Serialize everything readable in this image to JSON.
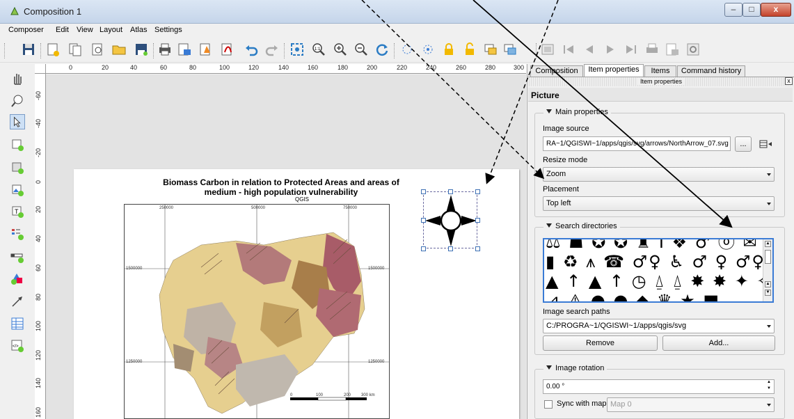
{
  "window": {
    "title": "Composition 1"
  },
  "menu": [
    "Composer",
    "Edit",
    "View",
    "Layout",
    "Atlas",
    "Settings"
  ],
  "ruler": {
    "h_labels": [
      "0",
      "20",
      "40",
      "60",
      "80",
      "100",
      "120",
      "140",
      "160",
      "180",
      "200",
      "220",
      "240",
      "260",
      "280",
      "300"
    ],
    "v_labels": [
      "-60",
      "-40",
      "-20",
      "0",
      "20",
      "40",
      "60",
      "80",
      "100",
      "120",
      "140",
      "160"
    ]
  },
  "map": {
    "title": "Biomass Carbon in relation to Protected Areas and areas of medium - high population vulnerability",
    "qgis_label": "QGIS",
    "coords": {
      "top_left": "250000",
      "top_mid": "500000",
      "top_right": "750000",
      "left_1": "1500000",
      "right_1": "1500000",
      "left_2": "1250000",
      "right_2": "1250000",
      "bottom_left": "250000",
      "bottom_mid": "500000",
      "bottom_right": "750000"
    },
    "scalebar": [
      "0",
      "100",
      "200",
      "300 km"
    ]
  },
  "panel": {
    "tabs": [
      "Composition",
      "Item properties",
      "Items",
      "Command history"
    ],
    "active_tab": "Item properties",
    "dock_title": "Item properties",
    "section": "Picture",
    "main_properties": {
      "title": "Main properties",
      "image_source_label": "Image source",
      "image_source_value": "RA~1/QGISWI~1/apps/qgis/svg/arrows/NorthArrow_07.svg",
      "browse_label": "...",
      "resize_mode_label": "Resize mode",
      "resize_mode_value": "Zoom",
      "placement_label": "Placement",
      "placement_value": "Top left"
    },
    "search_directories": {
      "title": "Search directories",
      "symbols_row1": "⚖ ☗ ✪ ✪ ♜ Ⅰ ❖ ♂ ⓞ ✉ ✉",
      "symbols_row2": "▮ ♻ ⩚ ☎ ♂♀ ♿ ♂ ♀ ♂♀ ⬆ ▲",
      "symbols_row3": "▲ ↑ ▲ ↑ ◷ ⍙ ⍙ ✸ ✸ ✦ ✧",
      "symbols_row4": "⊿ ⚠ ● ● ◆ ♛ ★ ■",
      "image_search_paths_label": "Image search paths",
      "image_search_paths_value": "C:/PROGRA~1/QGISWI~1/apps/qgis/svg",
      "remove_label": "Remove",
      "add_label": "Add..."
    },
    "image_rotation": {
      "title": "Image rotation",
      "value": "0.00 °",
      "sync_label": "Sync with map",
      "map_value": "Map 0"
    }
  },
  "colors": {
    "active_tab_border": "#3a7bd5",
    "handle": "#3c6fb4",
    "close_button": "#c4432b"
  }
}
